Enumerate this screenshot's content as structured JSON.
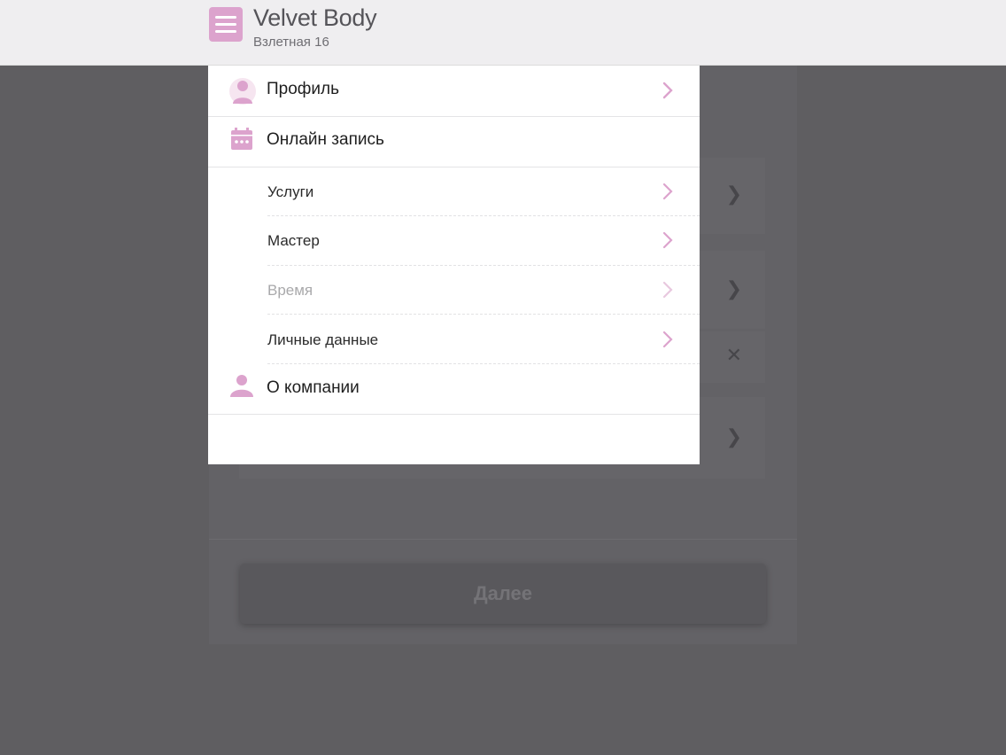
{
  "header": {
    "title": "Velvet Body",
    "subtitle": "Взлетная 16"
  },
  "menu": {
    "profile": "Профиль",
    "online_booking": "Онлайн запись",
    "sub_items": [
      {
        "label": "Услуги",
        "enabled": true
      },
      {
        "label": "Мастер",
        "enabled": true
      },
      {
        "label": "Время",
        "enabled": false
      },
      {
        "label": "Личные данные",
        "enabled": true
      }
    ],
    "about": "О компании"
  },
  "background": {
    "next_button": "Далее"
  },
  "colors": {
    "accent": "#dca3cd",
    "overlay": "#5f5e61",
    "header_bg": "#efeef0"
  }
}
